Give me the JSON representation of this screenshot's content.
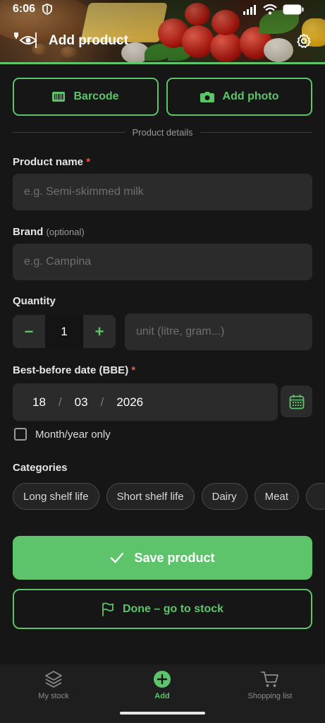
{
  "status_bar": {
    "time": "6:06"
  },
  "app_bar": {
    "title": "Add product"
  },
  "actions": {
    "barcode_label": "Barcode",
    "photo_label": "Add photo"
  },
  "section": {
    "divider_label": "Product details"
  },
  "form": {
    "product_name": {
      "label": "Product name",
      "required_mark": "*",
      "placeholder": "e.g. Semi-skimmed milk"
    },
    "brand": {
      "label": "Brand",
      "optional_label": "(optional)",
      "placeholder": "e.g. Campina"
    },
    "quantity": {
      "label": "Quantity",
      "minus": "−",
      "value": "1",
      "plus": "+",
      "unit_placeholder": "unit (litre, gram...)"
    },
    "bbe": {
      "label": "Best-before date (BBE)",
      "required_mark": "*",
      "day": "18",
      "month": "03",
      "year": "2026",
      "separator": "/"
    },
    "month_year_only": {
      "label": "Month/year only",
      "checked": false
    },
    "categories": {
      "label": "Categories",
      "chips": [
        "Long shelf life",
        "Short shelf life",
        "Dairy",
        "Meat",
        ""
      ]
    }
  },
  "buttons": {
    "save_label": "Save product",
    "done_label": "Done – go to stock"
  },
  "bottom_nav": {
    "items": [
      {
        "label": "My stock",
        "icon": "layers-icon",
        "active": false
      },
      {
        "label": "Add",
        "icon": "plus-circle-icon",
        "active": true
      },
      {
        "label": "Shopping list",
        "icon": "cart-icon",
        "active": false
      }
    ]
  },
  "colors": {
    "accent": "#5ec46c",
    "background": "#161616",
    "field": "#2b2b2b",
    "required": "#ef5350"
  }
}
